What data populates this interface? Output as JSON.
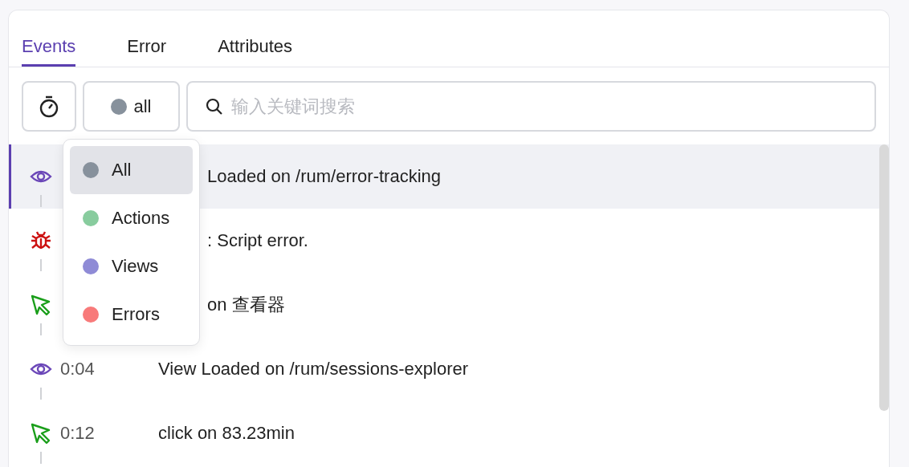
{
  "tabs": [
    {
      "label": "Events",
      "selected": true
    },
    {
      "label": "Error",
      "selected": false
    },
    {
      "label": "Attributes",
      "selected": false
    }
  ],
  "filter": {
    "value": "all",
    "color": "#87919c"
  },
  "search": {
    "placeholder": "输入关键词搜索"
  },
  "events": [
    {
      "kind": "view",
      "message": "Loaded on /rum/error-tracking",
      "selected": true
    },
    {
      "kind": "error",
      "message": ": Script error.",
      "selected": false
    },
    {
      "kind": "action",
      "message": "on 查看器",
      "selected": false
    },
    {
      "kind": "view",
      "time": "0:04",
      "message": "View Loaded on /rum/sessions-explorer",
      "selected": false
    },
    {
      "kind": "action",
      "time": "0:12",
      "message": "click on 83.23min",
      "selected": false
    }
  ],
  "menu": {
    "items": [
      {
        "label": "All",
        "color": "#87919c",
        "selected": true
      },
      {
        "label": "Actions",
        "color": "#88cc9e",
        "selected": false
      },
      {
        "label": "Views",
        "color": "#8f8bd6",
        "selected": false
      },
      {
        "label": "Errors",
        "color": "#f87a7a",
        "selected": false
      }
    ]
  }
}
